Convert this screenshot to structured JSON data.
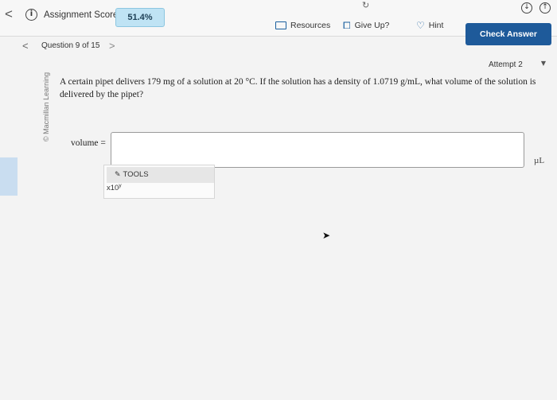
{
  "topbar": {
    "back_icon": "chevron-left-icon",
    "info_icon": "info-icon",
    "score_label": "Assignment Score:",
    "score_value": "51.4%",
    "resources_label": "Resources",
    "giveup_label": "Give Up?",
    "hint_label": "Hint",
    "check_answer_label": "Check Answer",
    "accent_color": "#1e5a9a",
    "score_badge_color": "#bfe3f4"
  },
  "question_nav": {
    "label": "Question 9 of 15"
  },
  "attempt": {
    "label": "Attempt 2"
  },
  "watermark": "© Macmillan Learning",
  "question": {
    "text": "A certain pipet delivers 179 mg of a solution at 20 °C. If the solution has a density of 1.0719 g/mL, what volume of the solution is delivered by the pipet?"
  },
  "answer": {
    "label": "volume =",
    "value": "",
    "unit": "µL"
  },
  "tools": {
    "header": "TOOLS",
    "x10_base": "x10",
    "x10_exp": "y"
  }
}
